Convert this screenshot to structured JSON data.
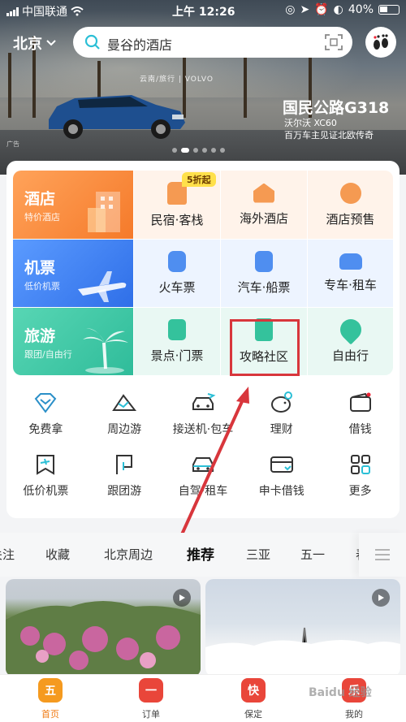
{
  "status_bar": {
    "carrier": "中国联通",
    "time": "上午 12:26",
    "battery": "40%"
  },
  "header": {
    "city": "北京",
    "search_placeholder": "曼谷的酒店"
  },
  "banner": {
    "brand_line": "云南/旅行 | VOLVO",
    "title": "国民公路G318",
    "subtitle1": "沃尔沃 XC60",
    "subtitle2": "百万车主见证北欧传奇",
    "ad_tag": "广告"
  },
  "grid": {
    "hotel": {
      "title": "酒店",
      "sub": "特价酒店"
    },
    "flight": {
      "title": "机票",
      "sub": "低价机票"
    },
    "travel": {
      "title": "旅游",
      "sub": "跟团/自由行"
    },
    "badge": "5折起",
    "items": [
      "民宿·客栈",
      "海外酒店",
      "酒店预售",
      "火车票",
      "汽车·船票",
      "专车·租车",
      "景点·门票",
      "攻略社区",
      "自由行"
    ]
  },
  "icon_row1": [
    "免费拿",
    "周边游",
    "接送机·包车",
    "理财",
    "借钱"
  ],
  "icon_row2": [
    "低价机票",
    "跟团游",
    "自驾·租车",
    "申卡借钱",
    "更多"
  ],
  "tabs": [
    "关注",
    "收藏",
    "北京周边",
    "推荐",
    "三亚",
    "五一",
    "春"
  ],
  "bottom_nav": [
    {
      "label": "首页",
      "glyph": "五"
    },
    {
      "label": "订单",
      "glyph": "一"
    },
    {
      "label": "保定",
      "glyph": "快"
    },
    {
      "label": "我的",
      "glyph": "乐"
    }
  ],
  "watermark": "Baidu 经验",
  "colors": {
    "hotel": "#f98a3a",
    "flight": "#3d7ff0",
    "travel": "#3cc6a6",
    "highlight": "#d8363c",
    "accent": "#2bbfd6"
  }
}
